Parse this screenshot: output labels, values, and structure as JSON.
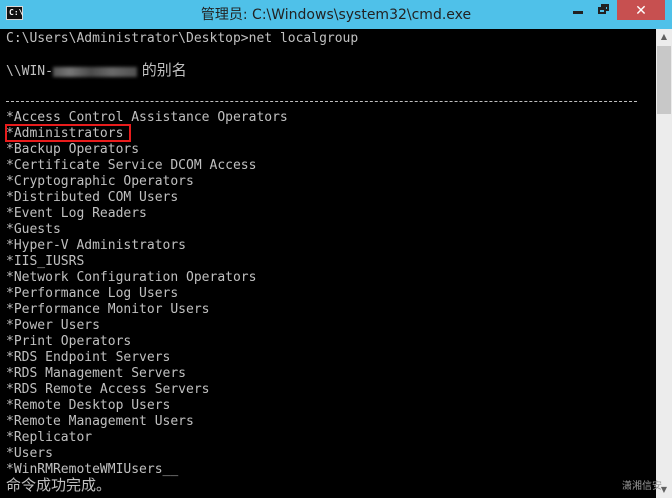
{
  "window": {
    "title": "管理员: C:\\Windows\\system32\\cmd.exe",
    "icon_label": "C:\\",
    "icon_name": "cmd-app-icon",
    "titlebar_color": "#4fc1e9",
    "close_color": "#c75050",
    "buttons": {
      "minimize_icon": "minimize-icon",
      "maximize_icon": "maximize-icon",
      "close_icon": "close-icon",
      "close_glyph": "✕"
    }
  },
  "console": {
    "prompt": "C:\\Users\\Administrator\\Desktop>",
    "command": "net localgroup",
    "alias_prefix": "\\\\WIN-",
    "alias_suffix": " 的别名",
    "groups": [
      "*Access Control Assistance Operators",
      "*Administrators",
      "*Backup Operators",
      "*Certificate Service DCOM Access",
      "*Cryptographic Operators",
      "*Distributed COM Users",
      "*Event Log Readers",
      "*Guests",
      "*Hyper-V Administrators",
      "*IIS_IUSRS",
      "*Network Configuration Operators",
      "*Performance Log Users",
      "*Performance Monitor Users",
      "*Power Users",
      "*Print Operators",
      "*RDS Endpoint Servers",
      "*RDS Management Servers",
      "*RDS Remote Access Servers",
      "*Remote Desktop Users",
      "*Remote Management Users",
      "*Replicator",
      "*Users",
      "*WinRMRemoteWMIUsers__"
    ],
    "completion": "命令成功完成。",
    "highlight_color": "#e81c1c",
    "text_color": "#c0c0c0"
  },
  "scrollbar": {
    "up_glyph": "▲",
    "down_glyph": "▼"
  },
  "watermark": "潇湘信安"
}
